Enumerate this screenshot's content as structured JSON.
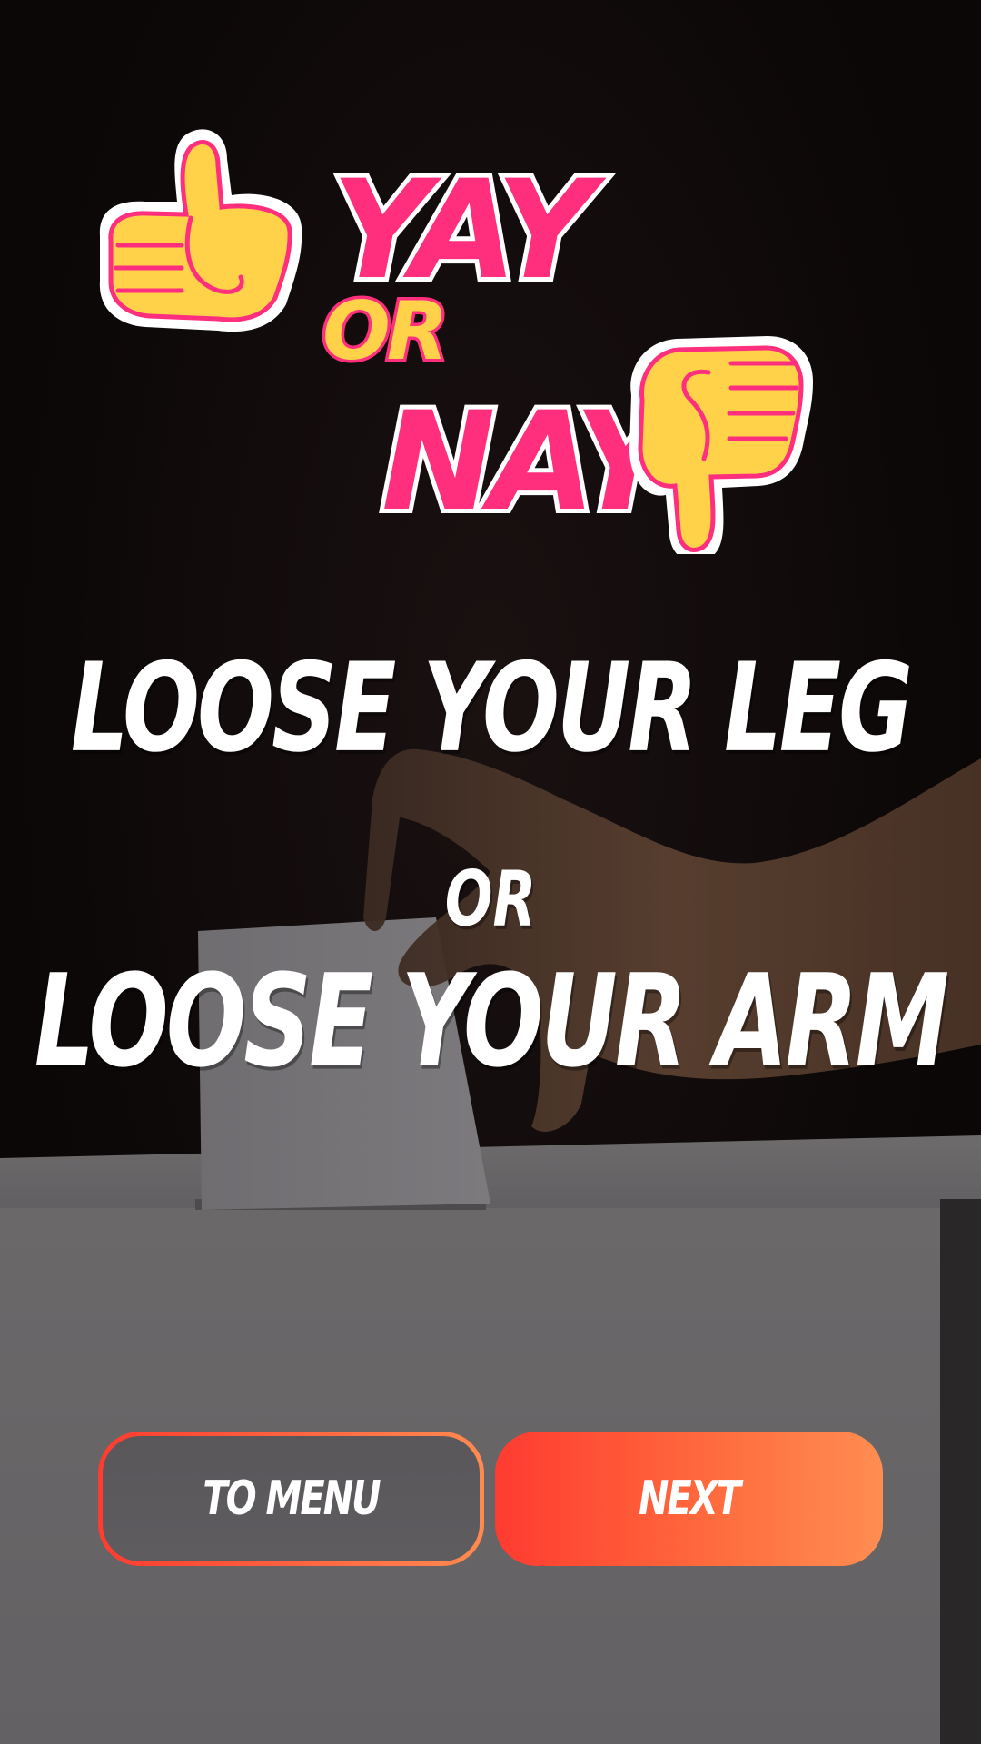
{
  "app": {
    "logo": {
      "line1": "YAY",
      "line2": "OR",
      "line3": "NAY",
      "icons": [
        "thumbs-up-icon",
        "thumbs-down-icon"
      ]
    }
  },
  "question": {
    "option_a": "LOOSE YOUR LEG",
    "separator": "OR",
    "option_b": "LOOSE YOUR ARM"
  },
  "buttons": {
    "to_menu": "TO MENU",
    "next": "NEXT"
  },
  "colors": {
    "accent_start": "#ff3b30",
    "accent_end": "#ff8d52",
    "logo_pink": "#ff2f7d",
    "logo_yellow": "#ffd24a",
    "text": "#ffffff"
  }
}
